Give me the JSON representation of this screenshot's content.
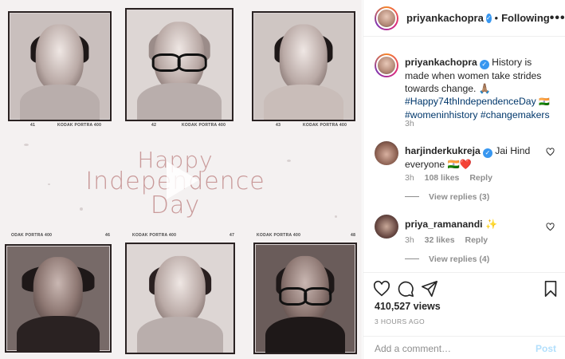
{
  "media": {
    "headline_line1": "Happy",
    "headline_line2": "Independence",
    "headline_line3": "Day",
    "film_labels": [
      "41",
      "KODAK PORTRA 400",
      "42",
      "KODAK PORTRA 400",
      "43",
      "KODAK PORTRA 400",
      "ODAK PORTRA 400",
      "46",
      "KODAK PORTRA 400",
      "47",
      "KODAK PORTRA 400",
      "48"
    ],
    "play_icon": "play-icon"
  },
  "header": {
    "username": "priyankachopra",
    "verified": "✓",
    "separator": "•",
    "follow_status": "Following",
    "more": "•••"
  },
  "caption": {
    "username": "priyankachopra",
    "text": "History is made when women take strides towards change. 🙏🏽",
    "hashtag1": "#Happy74thIndependenceDay",
    "flag": "🇮🇳",
    "hashtag2": "#womeninhistory #changemakers",
    "age": "3h"
  },
  "comments": [
    {
      "username": "harjinderkukreja",
      "text": "Jai Hind everyone 🇮🇳❤️",
      "age": "3h",
      "likes": "108 likes",
      "reply": "Reply",
      "view_replies": "View replies (3)"
    },
    {
      "username": "priya_ramanandi",
      "text": "✨",
      "age": "3h",
      "likes": "32 likes",
      "reply": "Reply",
      "view_replies": "View replies (4)"
    }
  ],
  "stats": {
    "views": "410,527 views",
    "posted": "3 HOURS AGO"
  },
  "compose": {
    "placeholder": "Add a comment…",
    "post_label": "Post"
  },
  "colors": {
    "link": "#00376b",
    "muted": "#8e8e8e",
    "verified": "#3897f0",
    "post_disabled": "#b2dffc",
    "headline": "#c99a9a"
  }
}
